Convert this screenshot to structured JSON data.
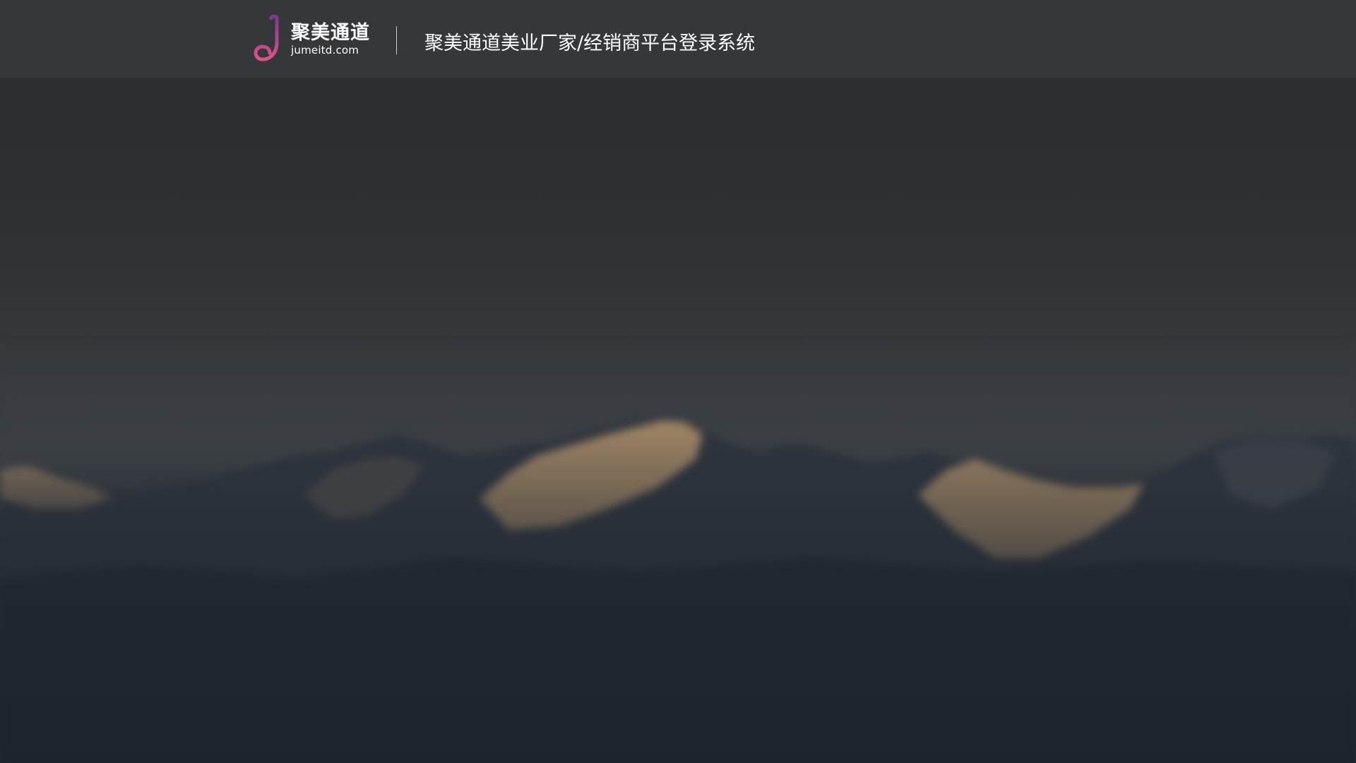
{
  "header": {
    "logo": {
      "name_cn": "聚美通道",
      "domain": "jumeitd.com",
      "icon": "jumeitd-logo-icon"
    },
    "system_title": "聚美通道美业厂家/经销商平台登录系统"
  },
  "background": {
    "description_icon": "mountain-background-image"
  },
  "colors": {
    "header_bg": "#3a3c3f",
    "logo_gradient_top": "#7b3a8c",
    "logo_gradient_bottom": "#e0508c",
    "text": "#ffffff"
  }
}
